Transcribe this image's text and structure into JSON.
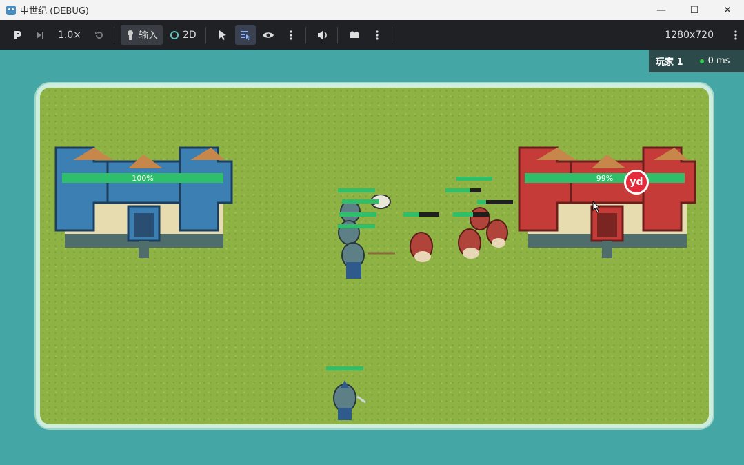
{
  "window": {
    "title": "中世纪 (DEBUG)",
    "minimize": "—",
    "maximize": "☐",
    "close": "✕"
  },
  "toolbar": {
    "speed": "1.0×",
    "input_label": "输入",
    "mode_2d": "2D",
    "resolution": "1280x720"
  },
  "overlay": {
    "player": "玩家 1",
    "latency": "0 ms",
    "latency_color": "#35d04a"
  },
  "castles": {
    "blue": {
      "health_label": "100%",
      "health": 1.0,
      "color": "#3b7fb3"
    },
    "red": {
      "health_label": "99%",
      "health": 0.99,
      "color": "#c43b37"
    }
  },
  "badge": {
    "text": "yd"
  },
  "units": {
    "blue_health": [
      1.0,
      1.0,
      1.0,
      1.0,
      1.0
    ],
    "red_health": [
      0.45,
      0.7,
      0.25,
      0.55,
      1.0
    ],
    "scout_health": 1.0
  },
  "colors": {
    "health_green": "#2fbf6b",
    "field": "#8fb244",
    "water": "#45a7a5"
  }
}
